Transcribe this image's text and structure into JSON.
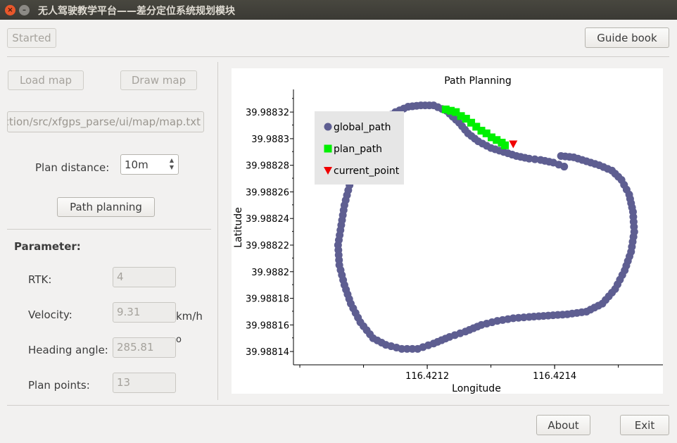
{
  "window": {
    "title": "无人驾驶教学平台——差分定位系统规划模块",
    "close_glyph": "×",
    "minimize_glyph": "–"
  },
  "toolbar": {
    "started_label": "Started",
    "guide_label": "Guide book"
  },
  "left_panel": {
    "load_map_label": "Load map",
    "draw_map_label": "Draw map",
    "map_path": "ction/src/xfgps_parse/ui/map/map.txt",
    "plan_distance_label": "Plan distance:",
    "plan_distance_value": "10m",
    "path_planning_label": "Path planning"
  },
  "parameters": {
    "heading": "Parameter:",
    "rtk_label": "RTK:",
    "rtk_value": "4",
    "velocity_label": "Velocity:",
    "velocity_value": "9.31",
    "velocity_unit": "km/h",
    "heading_label": "Heading angle:",
    "heading_value": "285.81",
    "heading_unit": "o",
    "plan_points_label": "Plan points:",
    "plan_points_value": "13"
  },
  "footer": {
    "about_label": "About",
    "exit_label": "Exit"
  },
  "chart_data": {
    "type": "scatter",
    "title": "Path Planning",
    "xlabel": "Longitude",
    "ylabel": "Latitude",
    "x_ticks": [
      116.4212,
      116.4214
    ],
    "x_tick_labels": [
      "116.4212",
      "116.4214"
    ],
    "y_ticks": [
      39.98814,
      39.98816,
      39.98818,
      39.9882,
      39.98822,
      39.98824,
      39.98826,
      39.98828,
      39.9883,
      39.98832
    ],
    "y_tick_labels": [
      "39.98814",
      "39.98816",
      "39.98818",
      "39.9882",
      "39.98822",
      "39.98824",
      "39.98826",
      "39.98828",
      "39.9883",
      "39.98832"
    ],
    "xlim": [
      116.42099,
      116.42157
    ],
    "ylim": [
      39.98813,
      39.988337
    ],
    "grid": false,
    "legend_position": "top-left",
    "series": [
      {
        "name": "global_path",
        "color": "#5e5e91",
        "marker": "circle",
        "points": [
          [
            116.421415,
            39.988279
          ],
          [
            116.421398,
            39.988282
          ],
          [
            116.421378,
            39.988284
          ],
          [
            116.42136,
            39.988285
          ],
          [
            116.42134,
            39.988287
          ],
          [
            116.42132,
            39.98829
          ],
          [
            116.4213,
            39.988293
          ],
          [
            116.42128,
            39.988298
          ],
          [
            116.421264,
            39.988304
          ],
          [
            116.42125,
            39.988312
          ],
          [
            116.42123,
            39.988321
          ],
          [
            116.42121,
            39.988325
          ],
          [
            116.42119,
            39.988325
          ],
          [
            116.42117,
            39.988324
          ],
          [
            116.42115,
            39.98832
          ],
          [
            116.42113,
            39.988314
          ],
          [
            116.421115,
            39.988305
          ],
          [
            116.4211,
            39.988293
          ],
          [
            116.42109,
            39.98828
          ],
          [
            116.421078,
            39.988265
          ],
          [
            116.42107,
            39.98825
          ],
          [
            116.421065,
            39.988235
          ],
          [
            116.42106,
            39.98822
          ],
          [
            116.421062,
            39.988205
          ],
          [
            116.42107,
            39.98819
          ],
          [
            116.42108,
            39.988176
          ],
          [
            116.421095,
            39.988162
          ],
          [
            116.421115,
            39.98815
          ],
          [
            116.421135,
            39.988145
          ],
          [
            116.42116,
            39.988142
          ],
          [
            116.421185,
            39.988142
          ],
          [
            116.42121,
            39.988146
          ],
          [
            116.421235,
            39.988151
          ],
          [
            116.42126,
            39.988155
          ],
          [
            116.421285,
            39.98816
          ],
          [
            116.42131,
            39.988163
          ],
          [
            116.421335,
            39.988165
          ],
          [
            116.42136,
            39.988166
          ],
          [
            116.42139,
            39.988167
          ],
          [
            116.42142,
            39.988168
          ],
          [
            116.42145,
            39.98817
          ],
          [
            116.421475,
            39.988176
          ],
          [
            116.421495,
            39.988187
          ],
          [
            116.42151,
            39.988201
          ],
          [
            116.42152,
            39.988215
          ],
          [
            116.421525,
            39.98823
          ],
          [
            116.421523,
            39.988245
          ],
          [
            116.421517,
            39.988258
          ],
          [
            116.421505,
            39.988269
          ],
          [
            116.42149,
            39.988276
          ],
          [
            116.42147,
            39.98828
          ],
          [
            116.42145,
            39.988283
          ],
          [
            116.42143,
            39.988286
          ],
          [
            116.42141,
            39.988287
          ]
        ]
      },
      {
        "name": "plan_path",
        "color": "#00f000",
        "marker": "square",
        "points": [
          [
            116.421229,
            39.988322
          ],
          [
            116.421237,
            39.988321
          ],
          [
            116.421245,
            39.98832
          ],
          [
            116.421253,
            39.988317
          ],
          [
            116.421261,
            39.988315
          ],
          [
            116.421269,
            39.988312
          ],
          [
            116.421277,
            39.988309
          ],
          [
            116.421285,
            39.988306
          ],
          [
            116.421293,
            39.988304
          ],
          [
            116.421301,
            39.988301
          ],
          [
            116.421309,
            39.988299
          ],
          [
            116.421317,
            39.988297
          ],
          [
            116.421322,
            39.988295
          ]
        ]
      },
      {
        "name": "current_point",
        "color": "#f00000",
        "marker": "triangle-down",
        "points": [
          [
            116.421335,
            39.988296
          ]
        ]
      }
    ]
  }
}
